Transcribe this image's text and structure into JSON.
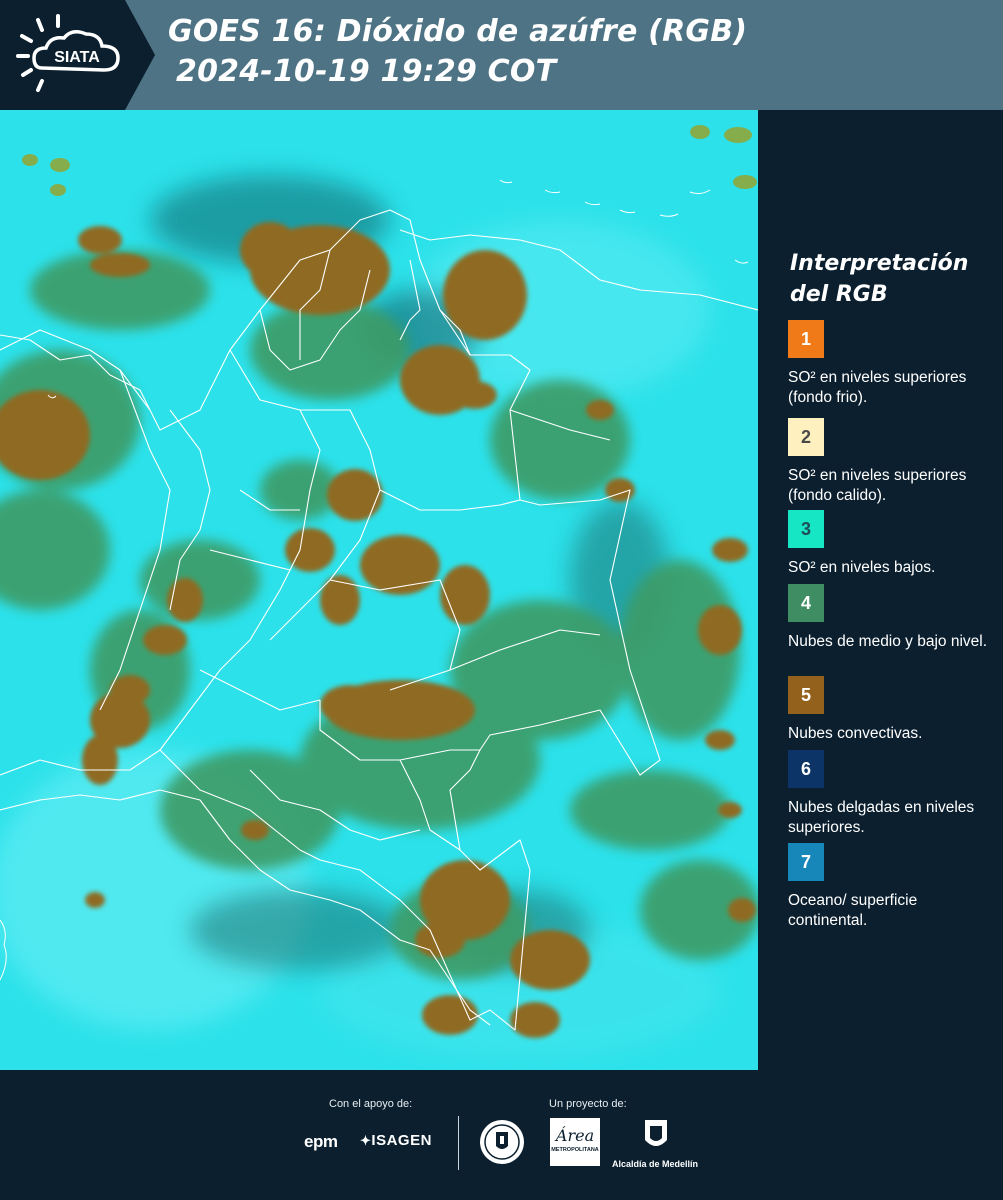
{
  "header": {
    "logo_text": "SIATA",
    "title_line1": "GOES 16: Dióxido de azúfre (RGB)",
    "title_line2": "2024-10-19 19:29 COT"
  },
  "legend": {
    "title": "Interpretación del RGB",
    "items": [
      {
        "number": "1",
        "color": "#f07a17",
        "text_color": "#ffffff",
        "label": "SO² en niveles superiores (fondo frio)."
      },
      {
        "number": "2",
        "color": "#fff1bf",
        "text_color": "#4a4a4a",
        "label": "SO² en niveles superiores (fondo calido)."
      },
      {
        "number": "3",
        "color": "#17e6c4",
        "text_color": "#1d4d57",
        "label": "SO² en niveles bajos."
      },
      {
        "number": "4",
        "color": "#3e8d63",
        "text_color": "#ffffff",
        "label": "Nubes de medio y bajo nivel."
      },
      {
        "number": "5",
        "color": "#94611d",
        "text_color": "#ffffff",
        "label": "Nubes convectivas."
      },
      {
        "number": "6",
        "color": "#0d3466",
        "text_color": "#ffffff",
        "label": "Nubes delgadas en niveles superiores."
      },
      {
        "number": "7",
        "color": "#1786b8",
        "text_color": "#ffffff",
        "label": "Oceano/ superficie continental."
      }
    ]
  },
  "footer": {
    "support_label": "Con el apoyo de:",
    "project_label": "Un proyecto de:",
    "epm_logo": "epm",
    "isagen_logo": "ISAGEN",
    "amva_logo": "Área",
    "amva_subtitle": "METROPOLITANA",
    "alcaldia_logo": "Alcaldía de Medellín"
  },
  "colors": {
    "header_bg": "#4d7384",
    "panel_bg": "#0b1f2e",
    "map_base": "#26e0e8",
    "convective": "#94611d",
    "mid_low_clouds": "#3e8d63",
    "borders": "#ffffff"
  }
}
